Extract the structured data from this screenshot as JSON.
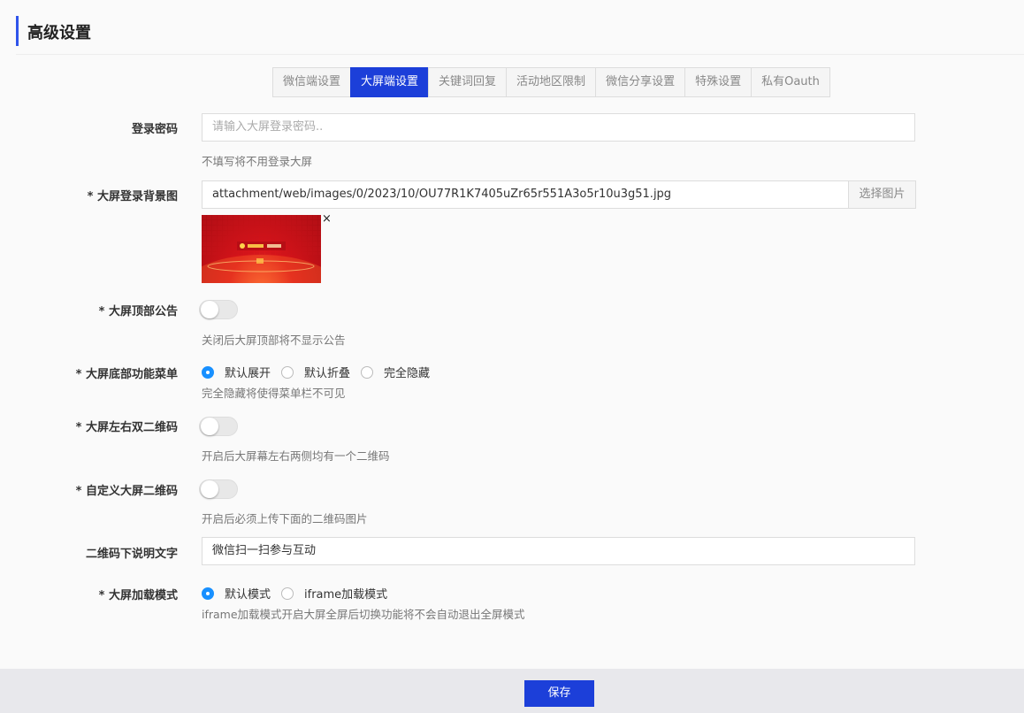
{
  "page": {
    "title": "高级设置"
  },
  "tabs": [
    {
      "label": "微信端设置",
      "active": false
    },
    {
      "label": "大屏端设置",
      "active": true
    },
    {
      "label": "关键词回复",
      "active": false
    },
    {
      "label": "活动地区限制",
      "active": false
    },
    {
      "label": "微信分享设置",
      "active": false
    },
    {
      "label": "特殊设置",
      "active": false
    },
    {
      "label": "私有Oauth",
      "active": false
    }
  ],
  "form": {
    "login_password": {
      "label": "登录密码",
      "value": "",
      "placeholder": "请输入大屏登录密码..",
      "help": "不填写将不用登录大屏"
    },
    "login_bg": {
      "label": "* 大屏登录背景图",
      "value": "attachment/web/images/0/2023/10/OU77R1K7405uZr65r551A3o5r10u3g51.jpg",
      "addon": "选择图片",
      "close_symbol": "×"
    },
    "top_notice": {
      "label": "* 大屏顶部公告",
      "enabled": false,
      "help": "关闭后大屏顶部将不显示公告"
    },
    "bottom_menu": {
      "label": "* 大屏底部功能菜单",
      "options": [
        "默认展开",
        "默认折叠",
        "完全隐藏"
      ],
      "selected": "默认展开",
      "help": "完全隐藏将使得菜单栏不可见"
    },
    "dual_qrcode": {
      "label": "* 大屏左右双二维码",
      "enabled": false,
      "help": "开启后大屏幕左右两侧均有一个二维码"
    },
    "custom_qrcode": {
      "label": "* 自定义大屏二维码",
      "enabled": false,
      "help": "开启后必须上传下面的二维码图片"
    },
    "qrcode_caption": {
      "label": "二维码下说明文字",
      "value": "微信扫一扫参与互动"
    },
    "load_mode": {
      "label": "* 大屏加载模式",
      "options": [
        "默认模式",
        "iframe加载模式"
      ],
      "selected": "默认模式",
      "help": "iframe加载模式开启大屏全屏后切换功能将不会自动退出全屏模式"
    }
  },
  "footer": {
    "save_label": "保存"
  },
  "colors": {
    "accent": "#1c3fd9",
    "radio_checked": "#1890ff"
  }
}
